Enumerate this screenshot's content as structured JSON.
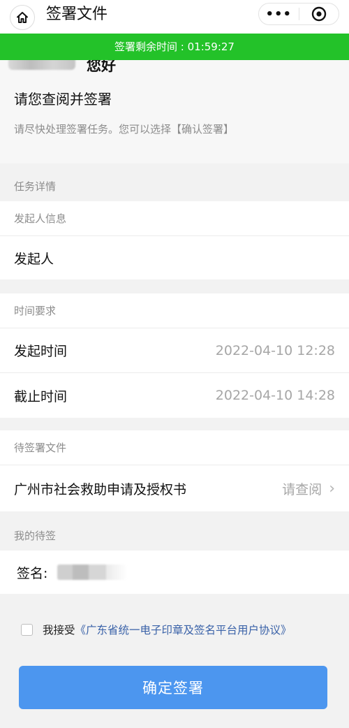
{
  "header": {
    "title": "签署文件",
    "more_icon": "more-dots-icon",
    "close_icon": "target-icon"
  },
  "timer": {
    "label": "签署剩余时间 : 01:59:27"
  },
  "greeting": {
    "hello": "您好",
    "title": "请您查阅并签署",
    "desc": "请尽快处理签署任务。您可以选择【确认签署】"
  },
  "task": {
    "section_title": "任务详情",
    "initiator_header": "发起人信息",
    "initiator_label": "发起人",
    "time_header": "时间要求",
    "start_label": "发起时间",
    "start_value": "2022-04-10 12:28",
    "end_label": "截止时间",
    "end_value": "2022-04-10 14:28"
  },
  "documents": {
    "header": "待签署文件",
    "name": "广州市社会救助申请及授权书",
    "action": "请查阅"
  },
  "my_pending": {
    "section_title": "我的待签",
    "signature_label": "签名:"
  },
  "agreement": {
    "prefix": "我接受",
    "link": "《广东省统一电子印章及签名平台用户协议》"
  },
  "confirm_button": "确定签署",
  "colors": {
    "timer_bg": "#23c229",
    "button_bg": "#4c96ef",
    "link": "#3a62a8"
  }
}
